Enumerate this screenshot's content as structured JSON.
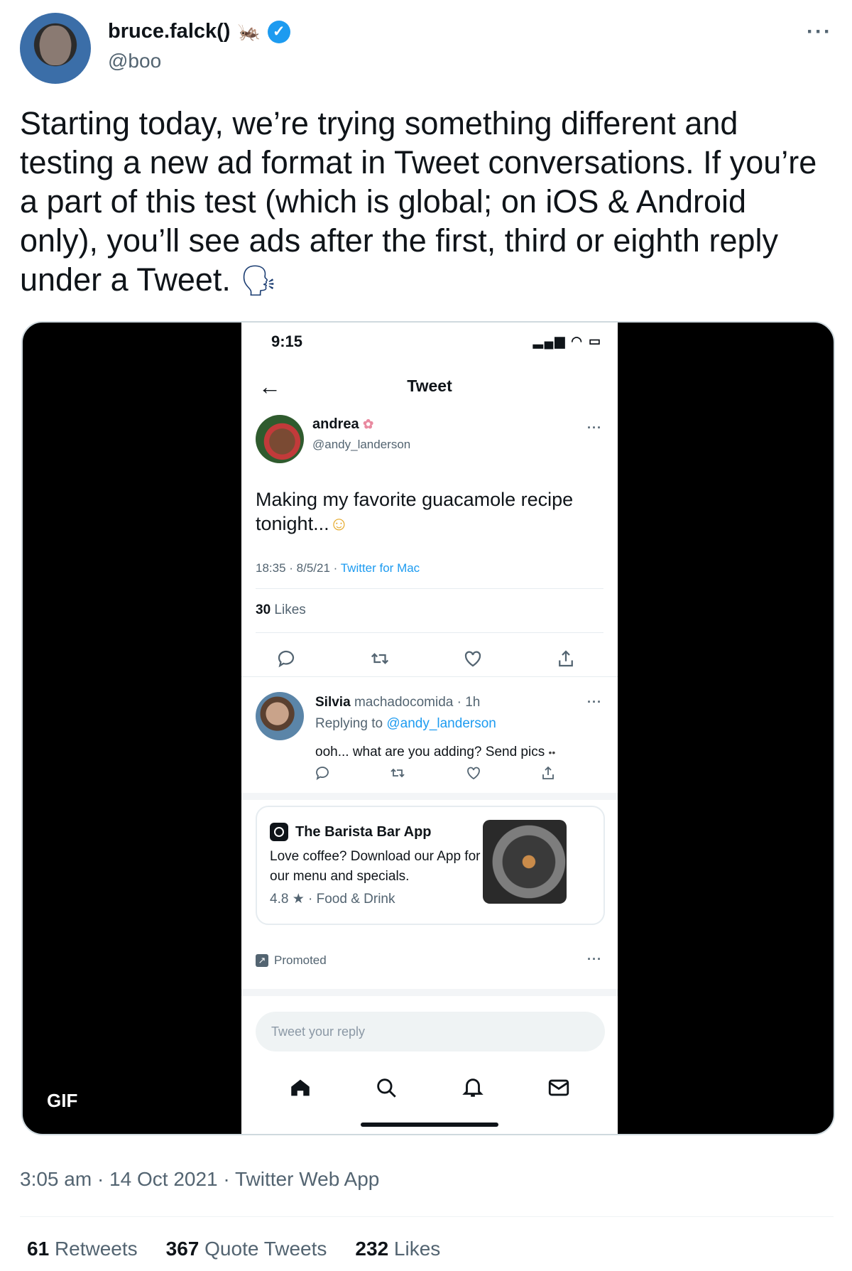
{
  "author": {
    "display_name": "bruce.falck()",
    "name_emoji": "🦗",
    "handle": "@boo",
    "verified_mark": "✓"
  },
  "more_label": "···",
  "tweet": {
    "text": "Starting today, we’re trying something different and testing a new ad format in Tweet conversations. If you’re a part of this test (which is global; on iOS & Android only), you’ll see ads after the first, third or eighth reply under a Tweet.",
    "emoji": "🗣"
  },
  "media": {
    "badge": "GIF",
    "phone": {
      "time": "9:15",
      "status_icons": "▂▄▆ ◠ ▭",
      "back_icon": "←",
      "title": "Tweet",
      "post": {
        "name": "andrea",
        "name_emoji": "✿",
        "handle": "@andy_landerson",
        "more": "···",
        "text": "Making my favorite guacamole recipe tonight...",
        "text_emoji": "☺",
        "meta_prefix": "18:35 · 8/5/21 · ",
        "meta_source": "Twitter for Mac",
        "likes_count": "30",
        "likes_label": "Likes"
      },
      "reply": {
        "name": "Silvia",
        "meta": "machadocomida · 1h",
        "more": "···",
        "replying_prefix": "Replying to ",
        "replying_handle": "@andy_landerson",
        "text": "ooh... what are you adding? Send pics",
        "text_emoji": "••"
      },
      "ad": {
        "name": "The Barista Bar App",
        "description": "Love coffee? Download our App for our menu and specials.",
        "rating": "4.8 ★ · Food & Drink",
        "promoted_icon": "↗",
        "promoted": "Promoted",
        "more": "···"
      },
      "reply_placeholder": "Tweet your reply"
    }
  },
  "footer": {
    "meta": "3:05 am · 14 Oct 2021 · Twitter Web App",
    "retweets_count": "61",
    "retweets_label": "Retweets",
    "quote_count": "367",
    "quote_label": "Quote Tweets",
    "likes_count": "232",
    "likes_label": "Likes"
  },
  "colors": {
    "accent": "#1d9bf0",
    "secondary_text": "#536471",
    "media_background": "#000000"
  }
}
